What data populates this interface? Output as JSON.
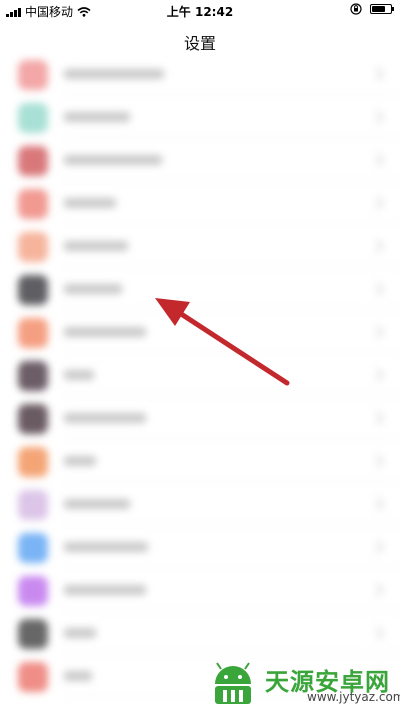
{
  "status_bar": {
    "carrier": "中国移动",
    "time": "上午 12:42"
  },
  "nav": {
    "title": "设置"
  },
  "list": {
    "rows": [
      {
        "icon_color": "#f3a7a7",
        "text_w": 100
      },
      {
        "icon_color": "#a8e0d5",
        "text_w": 66
      },
      {
        "icon_color": "#d9787a",
        "text_w": 98
      },
      {
        "icon_color": "#f19a92",
        "text_w": 52
      },
      {
        "icon_color": "#f6b49c",
        "text_w": 64
      },
      {
        "icon_color": "#5f5f63",
        "text_w": 58
      },
      {
        "icon_color": "#f59f82",
        "text_w": 82
      },
      {
        "icon_color": "#6c5d66",
        "text_w": 30
      },
      {
        "icon_color": "#6a5b62",
        "text_w": 82
      },
      {
        "icon_color": "#f4a576",
        "text_w": 32
      },
      {
        "icon_color": "#dcc5e8",
        "text_w": 66
      },
      {
        "icon_color": "#7ab4f5",
        "text_w": 84
      },
      {
        "icon_color": "#c98af0",
        "text_w": 82
      },
      {
        "icon_color": "#676767",
        "text_w": 32
      },
      {
        "icon_color": "#ef8e86",
        "text_w": 28
      }
    ]
  },
  "colors": {
    "arrow": "#c3282c",
    "watermark_green": "#3aa53a"
  },
  "watermark": {
    "title": "天源安卓网",
    "url": "www.jytyaz.com"
  }
}
